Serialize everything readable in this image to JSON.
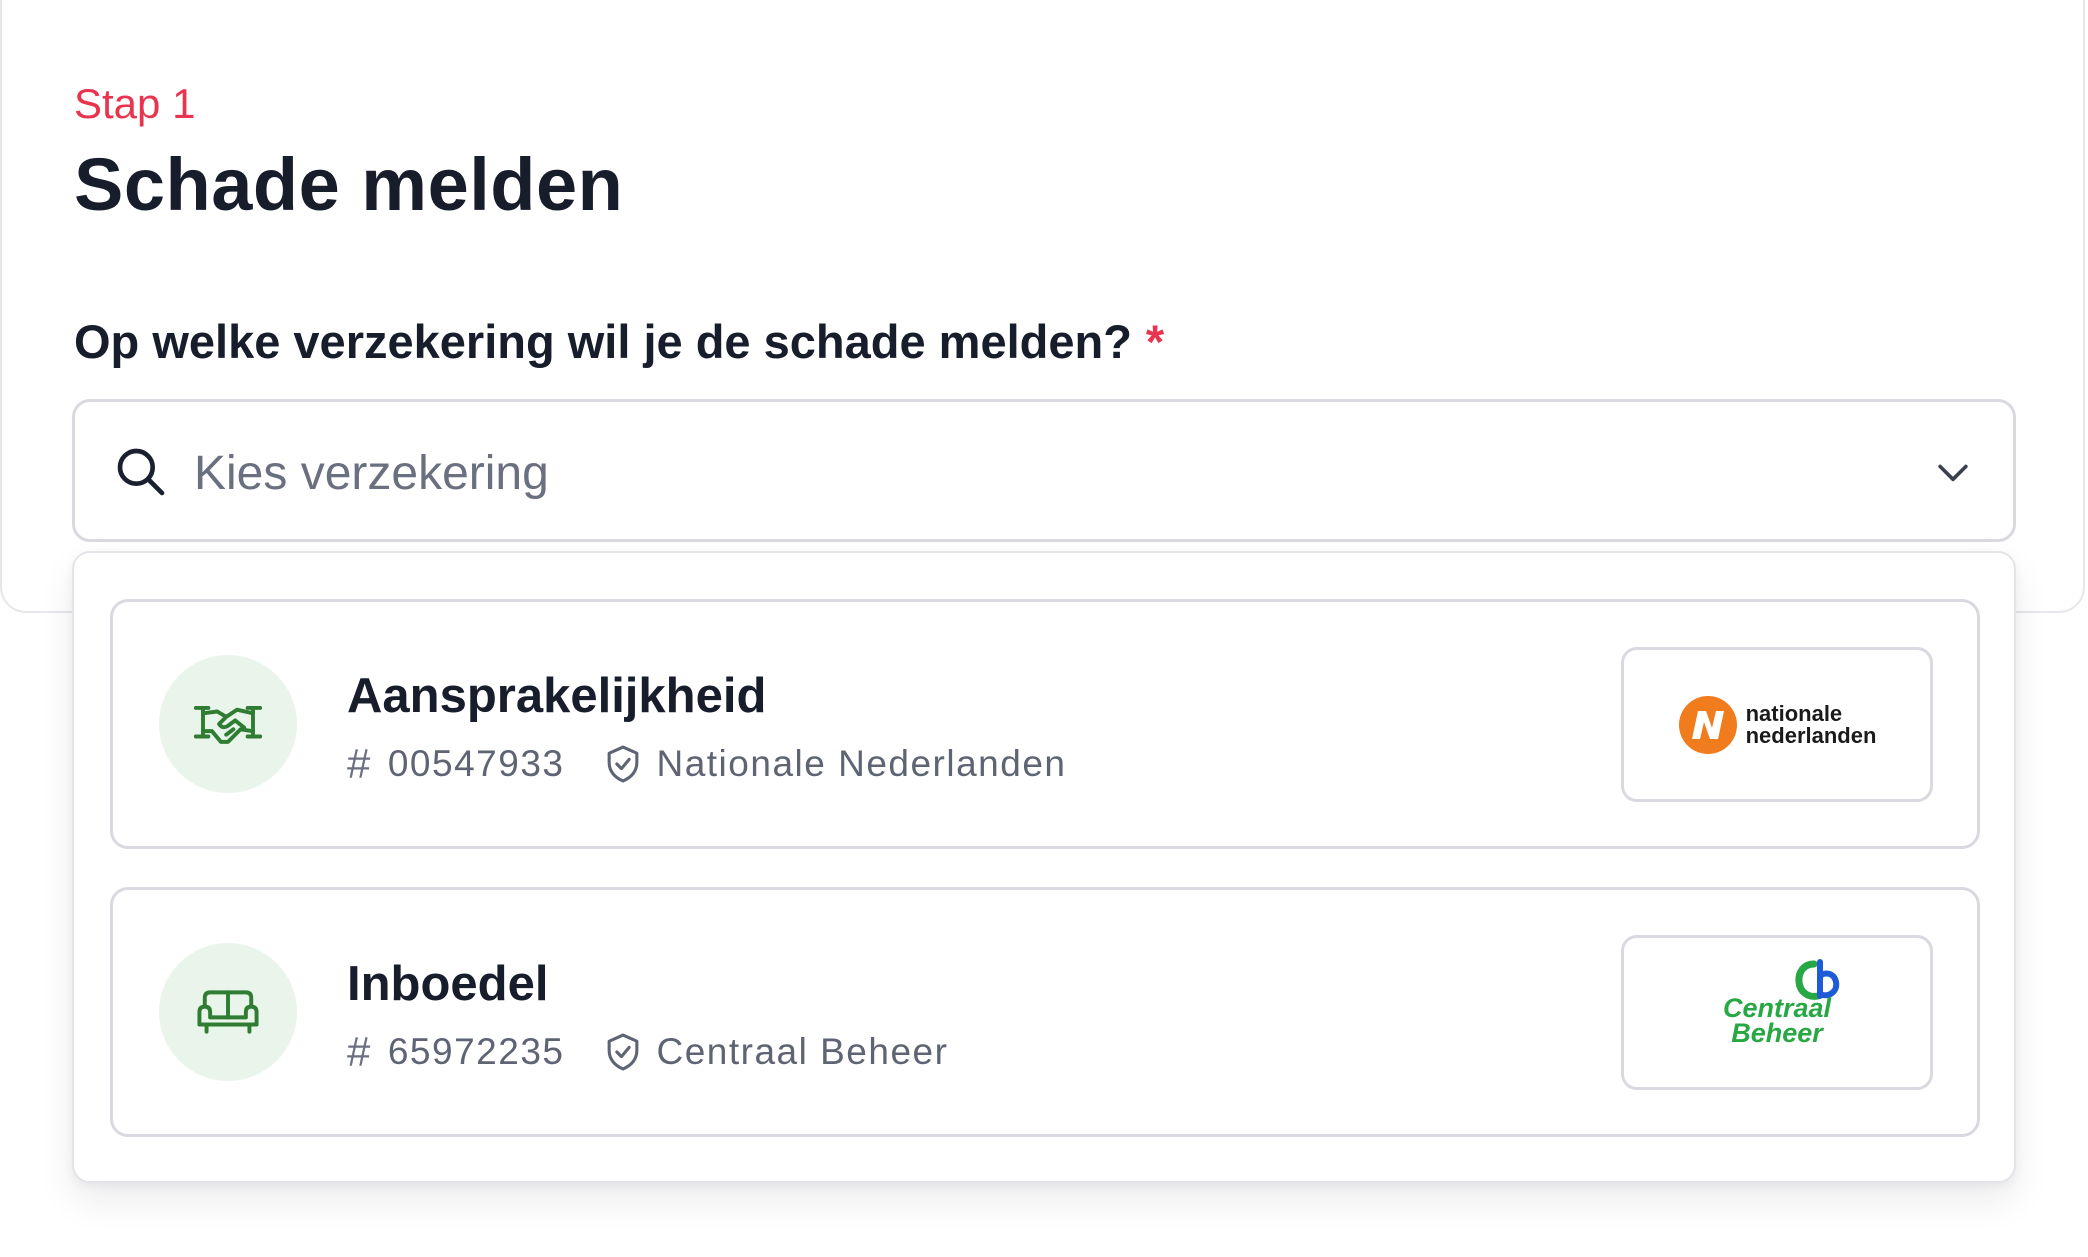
{
  "header": {
    "step_label": "Stap 1",
    "title": "Schade melden"
  },
  "question": {
    "label": "Op welke verzekering wil je de schade melden?",
    "required_marker": "*"
  },
  "select": {
    "placeholder": "Kies verzekering",
    "icon": "search-icon",
    "toggle_icon": "chevron-down-icon"
  },
  "options": [
    {
      "name": "Aansprakelijkheid",
      "hash": "#",
      "policy_number": "00547933",
      "insurer": "Nationale Nederlanden",
      "category_icon": "handshake-icon",
      "insurer_icon": "shield-icon",
      "logo": {
        "line1": "nationale",
        "line2": "nederlanden"
      }
    },
    {
      "name": "Inboedel",
      "hash": "#",
      "policy_number": "65972235",
      "insurer": "Centraal Beheer",
      "category_icon": "sofa-icon",
      "insurer_icon": "shield-icon",
      "logo": {
        "line1": "Centraal",
        "line2": "Beheer"
      }
    }
  ],
  "colors": {
    "accent": "#e8344e",
    "text": "#181d2b",
    "muted": "#6b7080",
    "icon_green": "#2e7d32",
    "icon_bg": "#e9f4ea",
    "border": "#d8dadf"
  }
}
